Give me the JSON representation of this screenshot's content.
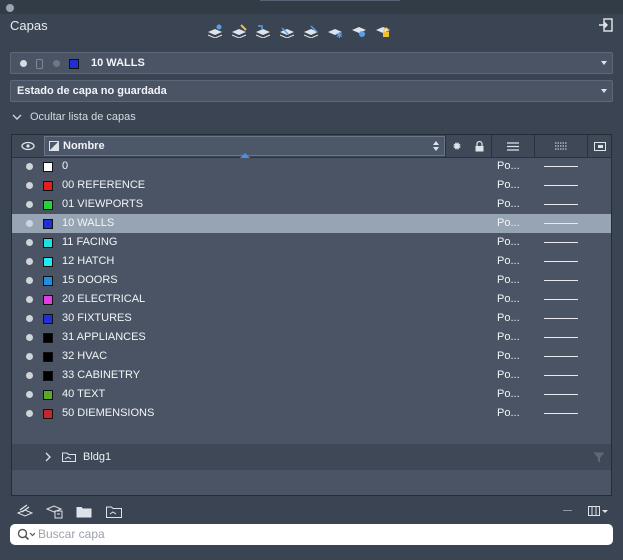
{
  "palette": {
    "title": "Capas"
  },
  "toolbar": {
    "icons": [
      "new-layer-icon",
      "new-layer-vp-icon",
      "delete-layer-icon",
      "set-current-icon",
      "layer-state-icon",
      "freeze-icon",
      "isolate-icon",
      "lock-icon"
    ]
  },
  "current_layer": {
    "name": "10 WALLS",
    "color": "#1f2fd6"
  },
  "layer_state": {
    "value": "Estado de capa no guardada"
  },
  "layer_list_toggle": {
    "label": "Ocultar lista de capas"
  },
  "columns": {
    "name": "Nombre"
  },
  "layers": [
    {
      "name": "0",
      "color": "#ffffff",
      "linetype": "Po..."
    },
    {
      "name": "00 REFERENCE",
      "color": "#e02020",
      "linetype": "Po..."
    },
    {
      "name": "01 VIEWPORTS",
      "color": "#22d33a",
      "linetype": "Po..."
    },
    {
      "name": "10 WALLS",
      "color": "#1f2fd6",
      "linetype": "Po...",
      "selected": true
    },
    {
      "name": "11 FACING",
      "color": "#22e0e0",
      "linetype": "Po..."
    },
    {
      "name": "12 HATCH",
      "color": "#28e6ef",
      "linetype": "Po..."
    },
    {
      "name": "15 DOORS",
      "color": "#1e8fe0",
      "linetype": "Po..."
    },
    {
      "name": "20 ELECTRICAL",
      "color": "#e040e0",
      "linetype": "Po..."
    },
    {
      "name": "30 FIXTURES",
      "color": "#2030d8",
      "linetype": "Po..."
    },
    {
      "name": "31 APPLIANCES",
      "color": "#000000",
      "linetype": "Po..."
    },
    {
      "name": "32 HVAC",
      "color": "#000000",
      "linetype": "Po..."
    },
    {
      "name": "33 CABINETRY",
      "color": "#000000",
      "linetype": "Po..."
    },
    {
      "name": "40 TEXT",
      "color": "#5aa82a",
      "linetype": "Po..."
    },
    {
      "name": "50 DIEMENSIONS",
      "color": "#c0282c",
      "linetype": "Po..."
    }
  ],
  "group": {
    "label": "Bldg1"
  },
  "search": {
    "placeholder": "Buscar capa"
  }
}
